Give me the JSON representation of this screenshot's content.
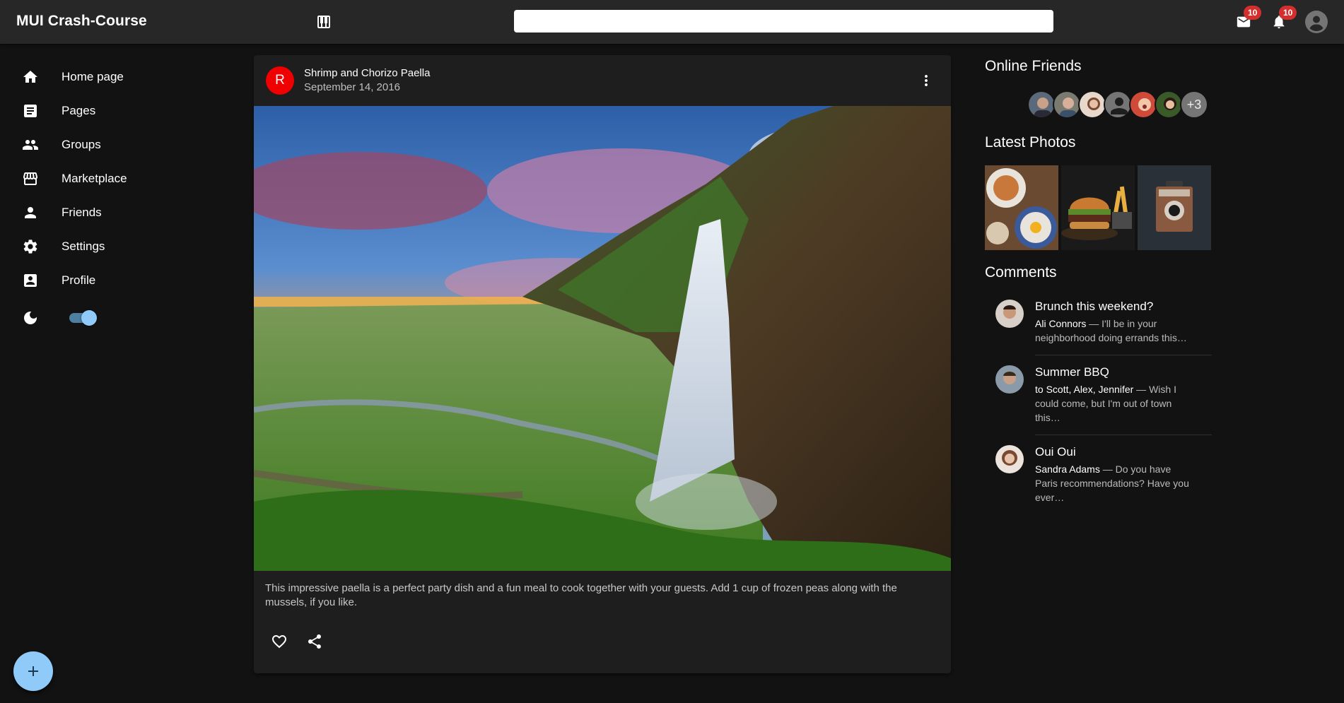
{
  "app": {
    "title": "MUI Crash-Course"
  },
  "appbar": {
    "search_placeholder": "",
    "mail_badge": "10",
    "notifications_badge": "10"
  },
  "sidebar": {
    "items": [
      {
        "label": "Home page",
        "icon": "home-icon"
      },
      {
        "label": "Pages",
        "icon": "article-icon"
      },
      {
        "label": "Groups",
        "icon": "group-icon"
      },
      {
        "label": "Marketplace",
        "icon": "storefront-icon"
      },
      {
        "label": "Friends",
        "icon": "person-icon"
      },
      {
        "label": "Settings",
        "icon": "settings-icon"
      },
      {
        "label": "Profile",
        "icon": "account-box-icon"
      }
    ],
    "dark_mode": true
  },
  "post": {
    "avatar_letter": "R",
    "title": "Shrimp and Chorizo Paella",
    "date": "September 14, 2016",
    "image_desc": "waterfall-landscape",
    "body": "This impressive paella is a perfect party dish and a fun meal to cook together with your guests. Add 1 cup of frozen peas along with the mussels, if you like."
  },
  "right": {
    "online_title": "Online Friends",
    "friends_more": "+3",
    "photos_title": "Latest Photos",
    "comments_title": "Comments",
    "comments": [
      {
        "title": "Brunch this weekend?",
        "author": "Ali Connors",
        "text": " — I'll be in your neighborhood doing errands this…"
      },
      {
        "title": "Summer BBQ",
        "author": "to Scott, Alex, Jennifer",
        "text": " — Wish I could come, but I'm out of town this…"
      },
      {
        "title": "Oui Oui",
        "author": "Sandra Adams",
        "text": " — Do you have Paris recommendations? Have you ever…"
      }
    ]
  },
  "colors": {
    "accent": "#90caf9",
    "avatar_red": "#f00000",
    "badge": "#d32f2f",
    "surface": "#1e1e1e",
    "background": "#121212"
  }
}
